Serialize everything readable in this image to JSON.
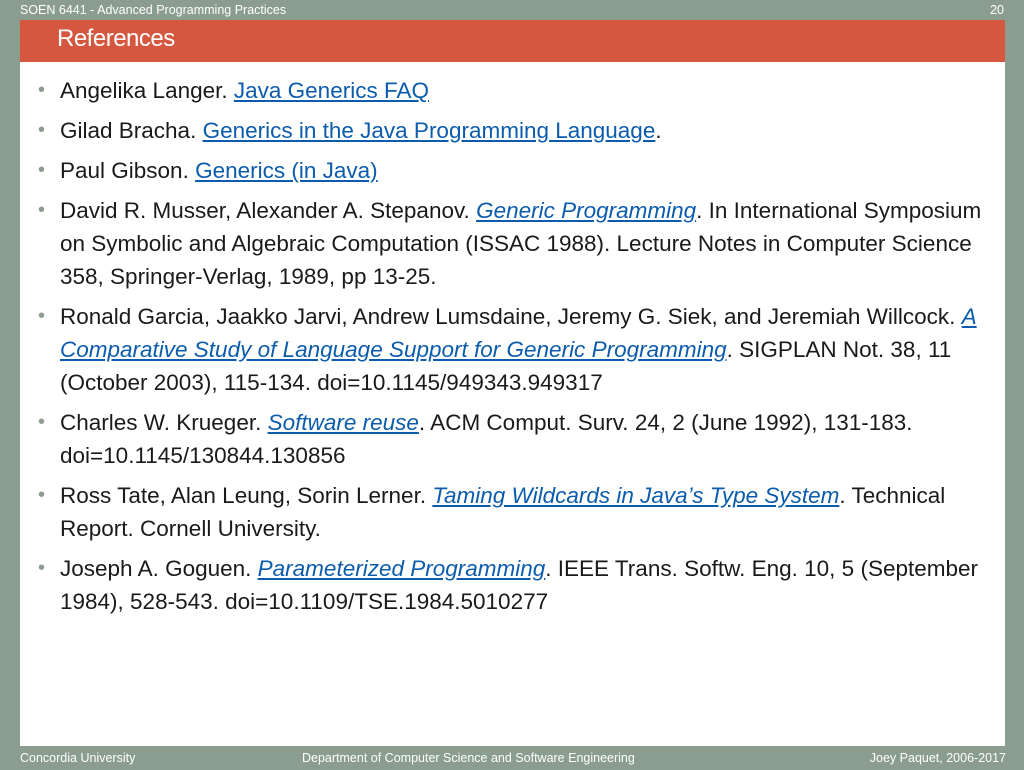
{
  "header": {
    "course": "SOEN 6441 - Advanced Programming Practices",
    "page_number": "20"
  },
  "slide": {
    "title": "References",
    "references": [
      {
        "before": "Angelika Langer. ",
        "link": "Java Generics FAQ",
        "italic": false,
        "after": ""
      },
      {
        "before": "Gilad Bracha. ",
        "link": "Generics in the Java Programming Language",
        "italic": false,
        "after": "."
      },
      {
        "before": "Paul Gibson. ",
        "link": "Generics (in Java)",
        "italic": false,
        "after": ""
      },
      {
        "before": "David R. Musser, Alexander A. Stepanov. ",
        "link": "Generic Programming",
        "italic": true,
        "after": ". In International Symposium on Symbolic and Algebraic Computation (ISSAC 1988). Lecture Notes in Computer Science 358, Springer-Verlag, 1989, pp 13-25."
      },
      {
        "before": "Ronald Garcia, Jaakko Jarvi, Andrew Lumsdaine, Jeremy G. Siek, and Jeremiah Willcock. ",
        "link": "A Comparative Study of Language Support for Generic Programming",
        "italic": true,
        "after": ". SIGPLAN Not. 38, 11 (October 2003), 115-134. doi=10.1145/949343.949317"
      },
      {
        "before": "Charles W. Krueger. ",
        "link": "Software reuse",
        "italic": true,
        "after": ". ACM Comput. Surv. 24, 2 (June 1992), 131-183. doi=10.1145/130844.130856"
      },
      {
        "before": "Ross Tate, Alan Leung, Sorin Lerner. ",
        "link": "Taming Wildcards in Java’s Type System",
        "italic": true,
        "after": ". Technical Report. Cornell University."
      },
      {
        "before": "Joseph A. Goguen. ",
        "link": "Parameterized Programming",
        "italic": true,
        "after": ". IEEE Trans. Softw. Eng. 10, 5 (September 1984), 528-543. doi=10.1109/TSE.1984.5010277"
      }
    ]
  },
  "footer": {
    "left": "Concordia University",
    "center": "Department of Computer Science and Software Engineering",
    "right": "Joey Paquet, 2006-2017"
  },
  "colors": {
    "background": "#8a9d8f",
    "title_bar": "#d5573f",
    "link": "#0b5cad"
  }
}
